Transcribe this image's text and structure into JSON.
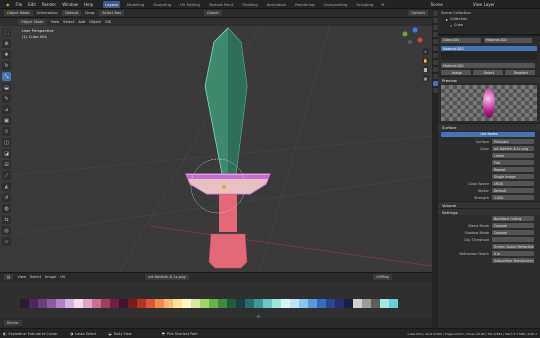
{
  "topbar": {
    "menus": [
      "File",
      "Edit",
      "Render",
      "Window",
      "Help"
    ],
    "tabs": [
      "Layout",
      "Modeling",
      "Sculpting",
      "UV Editing",
      "Texture Paint",
      "Shading",
      "Animation",
      "Rendering",
      "Compositing",
      "Scripting"
    ],
    "active_tab": "Layout",
    "scene_label": "Scene",
    "view_layer_label": "View Layer"
  },
  "viewport_header": {
    "mode": "Object Mode",
    "orientation_label": "Orientation:",
    "orientation_value": "Default",
    "drag_label": "Drag:",
    "drag_value": "Select Box",
    "menus": [
      "View",
      "Select",
      "Add",
      "Object",
      "GIS"
    ],
    "transform": "Global",
    "options": "Options"
  },
  "viewport": {
    "view_name": "User Perspective",
    "collection_info": "(1) Cube.004",
    "tools": [
      "select",
      "cursor",
      "move",
      "rotate",
      "scale",
      "transform",
      "annotate",
      "measure",
      "add-cube",
      "extrude",
      "inset",
      "bevel",
      "loop-cut",
      "knife",
      "poly-build",
      "spin",
      "smooth",
      "edge-slide",
      "shrink",
      "shear",
      "rip"
    ]
  },
  "image_editor_header": {
    "menus": [
      "View",
      "Select",
      "Image",
      "UV"
    ],
    "image_name": "art-faketrik-8.1x.png",
    "uvmap": "UVMap"
  },
  "palette": {
    "colors": [
      "#2b1b33",
      "#4a2a55",
      "#6b3d7a",
      "#8e5aa0",
      "#b382c2",
      "#d9b2dd",
      "#f2dcef",
      "#e0a6c4",
      "#c9708f",
      "#9e3f5e",
      "#6e2243",
      "#3f1530",
      "#7b1a1a",
      "#b3342b",
      "#e0553a",
      "#f28a4a",
      "#f7bb6a",
      "#fbe39a",
      "#fff6c9",
      "#d8eaa0",
      "#a4d46e",
      "#6cb24a",
      "#3f8a3d",
      "#215c3a",
      "#1d3f3f",
      "#2b6a6e",
      "#3d9a9a",
      "#66c9c2",
      "#a1e6da",
      "#d4f6ef",
      "#bfe2f7",
      "#8cc4ec",
      "#5a9ad8",
      "#3b6bb8",
      "#2c4790",
      "#22306a",
      "#1b1f45",
      "#d0d0d0",
      "#9c9c9c",
      "#5e5e5e",
      "#a0e7e5",
      "#63d2d8"
    ]
  },
  "outliner": {
    "title": "Scene Collection",
    "items": [
      "Collection",
      "Cube"
    ]
  },
  "properties": {
    "object_name": "Cube.004",
    "material_slot": "Material.002",
    "material_list": [
      "Material.003"
    ],
    "material_field": "Material.002",
    "slot_buttons": [
      "Assign",
      "Select",
      "Deselect"
    ],
    "preview_label": "Preview",
    "surface_label": "Surface",
    "use_nodes": "Use Nodes",
    "rows": [
      {
        "label": "Surface",
        "value": "Emission"
      },
      {
        "label": "Color",
        "value": "art-faketrik-8.1x.png"
      },
      {
        "label": "",
        "value": "Linear"
      },
      {
        "label": "",
        "value": "Flat"
      },
      {
        "label": "",
        "value": "Repeat"
      },
      {
        "label": "",
        "value": "Single Image"
      },
      {
        "label": "Color Space",
        "value": "sRGB"
      },
      {
        "label": "Vector",
        "value": "Default"
      },
      {
        "label": "Strength",
        "value": "1.000"
      }
    ],
    "volume_label": "Volume",
    "settings_label": "Settings",
    "settings_rows": [
      {
        "label": "",
        "value": "Backface Culling"
      },
      {
        "label": "Blend Mode",
        "value": "Opaque"
      },
      {
        "label": "Shadow Mode",
        "value": "Opaque"
      },
      {
        "label": "Clip Threshold",
        "value": ""
      },
      {
        "label": "",
        "value": "Screen Space Refraction"
      },
      {
        "label": "Refraction Depth",
        "value": "0 m"
      },
      {
        "label": "",
        "value": "Subsurface Translucency"
      }
    ]
  },
  "status": {
    "left": "Explode or Extrude to Cursor",
    "mid1": "Lasso Select",
    "mid2": "Dolly View",
    "mid3": "Pick Shortest Path",
    "right": "Cube.004 | Verts 0/450 | Edges 0/212 | Faces 0/196 | Tris 0/392 | Mem 5.7 MiB | 2.90.1"
  },
  "colors": {
    "accent": "#4772b3",
    "blade": "#3f8a6f",
    "blade_edge": "#7fd8b2",
    "guard_top": "#d48adf",
    "handle": "#e2687a"
  }
}
